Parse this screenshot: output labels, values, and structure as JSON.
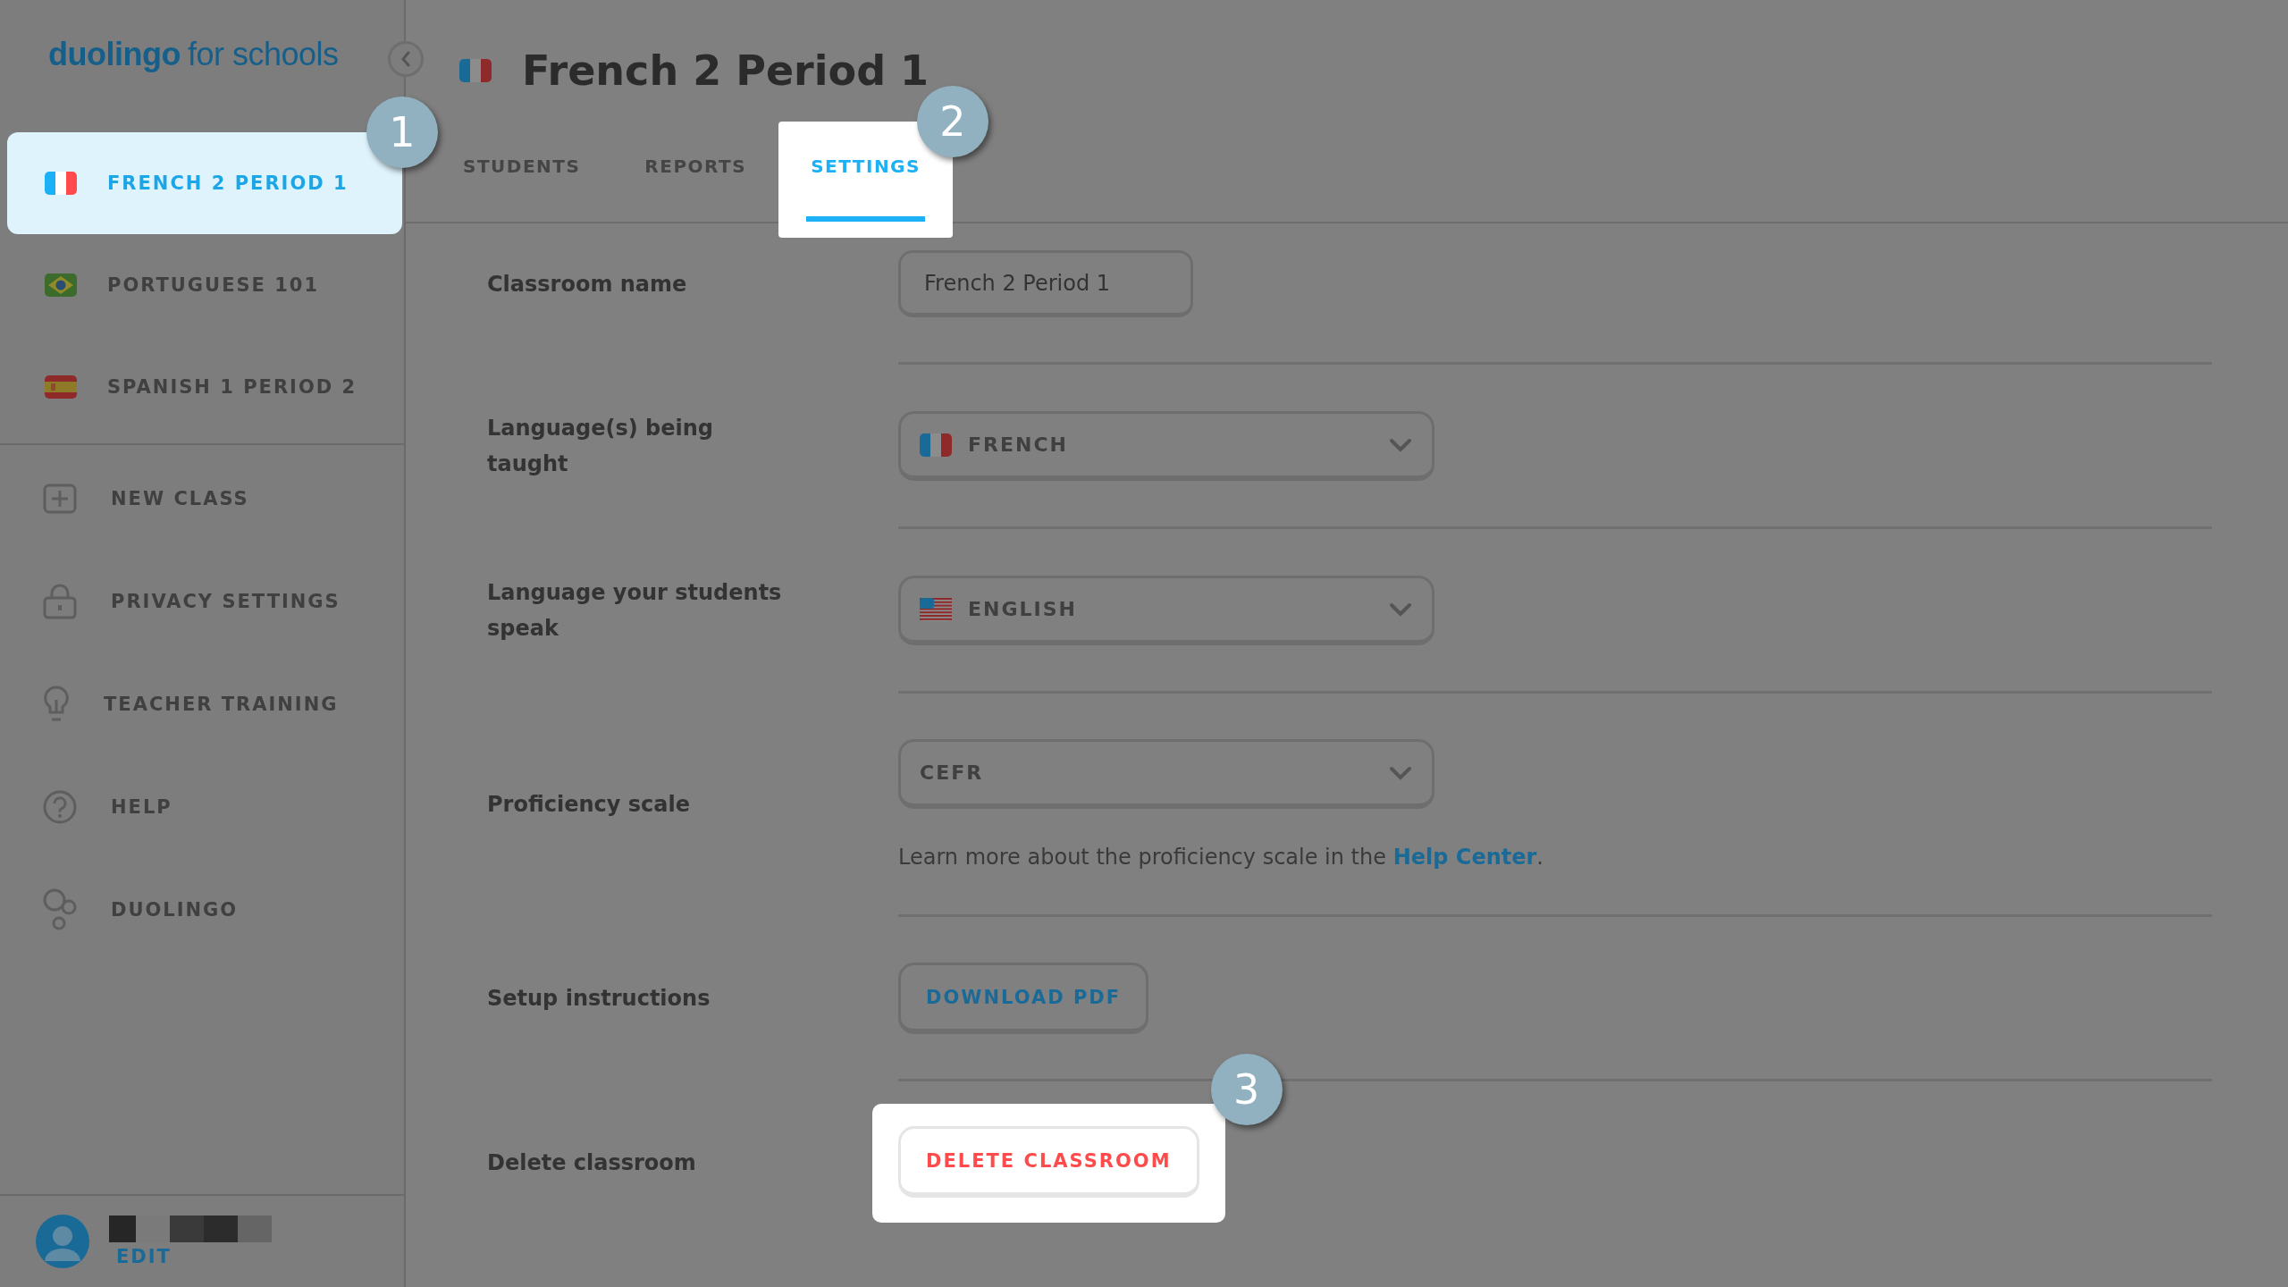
{
  "logo": {
    "brand": "duolingo",
    "suffix": "for schools"
  },
  "sidebar": {
    "classes": [
      {
        "label": "FRENCH 2 PERIOD 1",
        "kind": "france",
        "selected": true,
        "callout": "1"
      },
      {
        "label": "PORTUGUESE 101",
        "kind": "brazil",
        "selected": false
      },
      {
        "label": "SPANISH 1 PERIOD 2",
        "kind": "spain",
        "selected": false
      }
    ],
    "links": [
      {
        "label": "NEW CLASS",
        "kind": "plus"
      },
      {
        "label": "PRIVACY SETTINGS",
        "kind": "lock"
      },
      {
        "label": "TEACHER TRAINING",
        "kind": "bulb"
      },
      {
        "label": "HELP",
        "kind": "help"
      },
      {
        "label": "DUOLINGO",
        "kind": "bubbles"
      }
    ],
    "user": {
      "action": "EDIT"
    }
  },
  "header": {
    "title": "French 2 Period 1",
    "kind": "france"
  },
  "tabs": [
    {
      "label": "STUDENTS",
      "selected": false
    },
    {
      "label": "REPORTS",
      "selected": false
    },
    {
      "label": "SETTINGS",
      "selected": true,
      "callout": "2"
    }
  ],
  "settings": [
    {
      "kind": "text_input",
      "label": "Classroom name",
      "value": "French 2 Period 1"
    },
    {
      "kind": "select",
      "label": "Language(s) being taught",
      "option": {
        "kind": "france",
        "label": "FRENCH"
      }
    },
    {
      "kind": "select",
      "label": "Language your students speak",
      "option": {
        "kind": "usa",
        "label": "ENGLISH"
      }
    },
    {
      "kind": "select",
      "label": "Proficiency scale",
      "option": {
        "kind": "plain",
        "label": "CEFR"
      },
      "note": {
        "text": "Learn more about the proficiency scale in the",
        "link": "Help Center",
        "end": "."
      }
    },
    {
      "kind": "button",
      "label": "Setup instructions",
      "button": "DOWNLOAD PDF"
    },
    {
      "kind": "danger_button",
      "label": "Delete classroom",
      "button": "DELETE CLASSROOM",
      "callout": "3"
    }
  ]
}
